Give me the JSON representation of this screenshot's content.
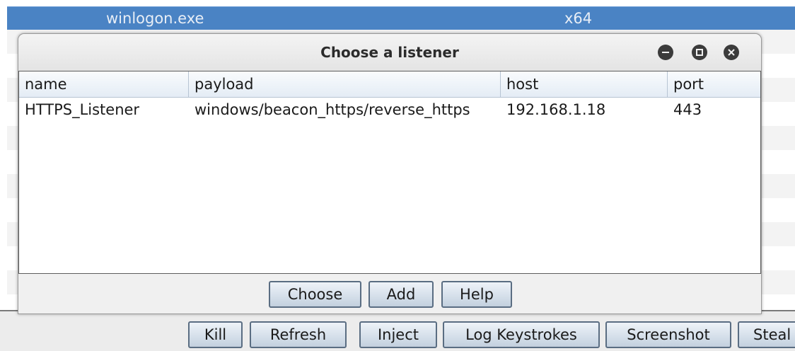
{
  "background_window": {
    "header_cells": [
      "winlogon.exe",
      "x64"
    ],
    "buttons": [
      "Kill",
      "Refresh",
      "Inject",
      "Log Keystrokes",
      "Screenshot",
      "Steal"
    ]
  },
  "dialog": {
    "title": "Choose a listener",
    "window_controls": [
      "minimize-icon",
      "maximize-icon",
      "close-icon"
    ],
    "columns": [
      "name",
      "payload",
      "host",
      "port"
    ],
    "rows": [
      {
        "name": "HTTPS_Listener",
        "payload": "windows/beacon_https/reverse_https",
        "host": "192.168.1.18",
        "port": "443"
      }
    ],
    "buttons": {
      "choose": "Choose",
      "add": "Add",
      "help": "Help"
    }
  },
  "colors": {
    "header_blue": "#4a83c4",
    "window_control": "#3b3b3b",
    "button_border": "#5a6d82"
  }
}
